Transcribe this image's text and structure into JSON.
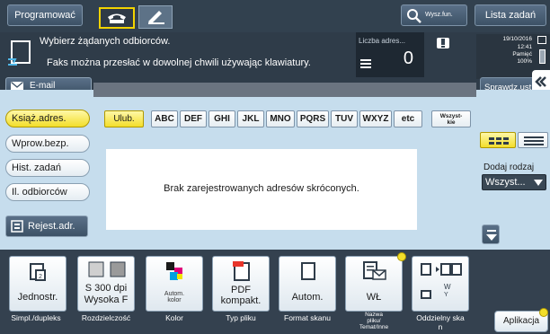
{
  "topbar": {
    "program_label": "Programować",
    "search_label": "Wysz.fun.",
    "job_list_label": "Lista zadań"
  },
  "message": {
    "line1": "Wybierz żądanych odbiorców.",
    "line2": "Faks można przesłać w dowolnej chwili używając klawiatury.",
    "counter_label": "Liczba adres...",
    "counter_value": "0"
  },
  "status": {
    "date": "19/10/2016",
    "time": "12:41",
    "memory_label": "Pamięć",
    "memory_value": "100%"
  },
  "email_tab": {
    "label": "E-mail"
  },
  "check_button": {
    "label": "Sprawdz.ust."
  },
  "side_nav": {
    "items": [
      {
        "label": "Książ.adres."
      },
      {
        "label": "Wprow.bezp."
      },
      {
        "label": "Hist. zadań"
      },
      {
        "label": "Il. odbiorców"
      }
    ],
    "register_label": "Rejest.adr."
  },
  "alpha_tabs": [
    "Ulub.",
    "ABC",
    "DEF",
    "GHI",
    "JKL",
    "MNO",
    "PQRS",
    "TUV",
    "WXYZ",
    "etc"
  ],
  "all_tab": {
    "label_line1": "Wszyst-",
    "label_line2": "kie"
  },
  "empty_message": "Brak zarejestrowanych adresów skróconych.",
  "add_kind": {
    "label": "Dodaj rodzaj",
    "value": "Wszyst..."
  },
  "functions": [
    {
      "tile": "Jednostr.",
      "caption": "Simpl./dupleks"
    },
    {
      "tile_line1": "S 300 dpi",
      "tile_line2": "Wysoka F",
      "caption": "Rozdzielczość"
    },
    {
      "tile_line1": "Autom.",
      "tile_line2": "kolor",
      "caption": "Kolor"
    },
    {
      "tile_line1": "PDF",
      "tile_line2": "kompakt.",
      "caption": "Typ pliku"
    },
    {
      "tile": "Autom.",
      "caption": "Format skanu"
    },
    {
      "tile": "WŁ",
      "caption_line1": "Nazwa",
      "caption_line2": "pliku/",
      "caption_line3": "Temat/Inne"
    },
    {
      "caption": "Oddzielny ska",
      "caption_line2": "n"
    }
  ],
  "application_label": "Aplikacja",
  "colors": {
    "dark_bar": "#32414f",
    "panel_blue": "#c6dded",
    "active_yellow": "#f3de2a"
  }
}
